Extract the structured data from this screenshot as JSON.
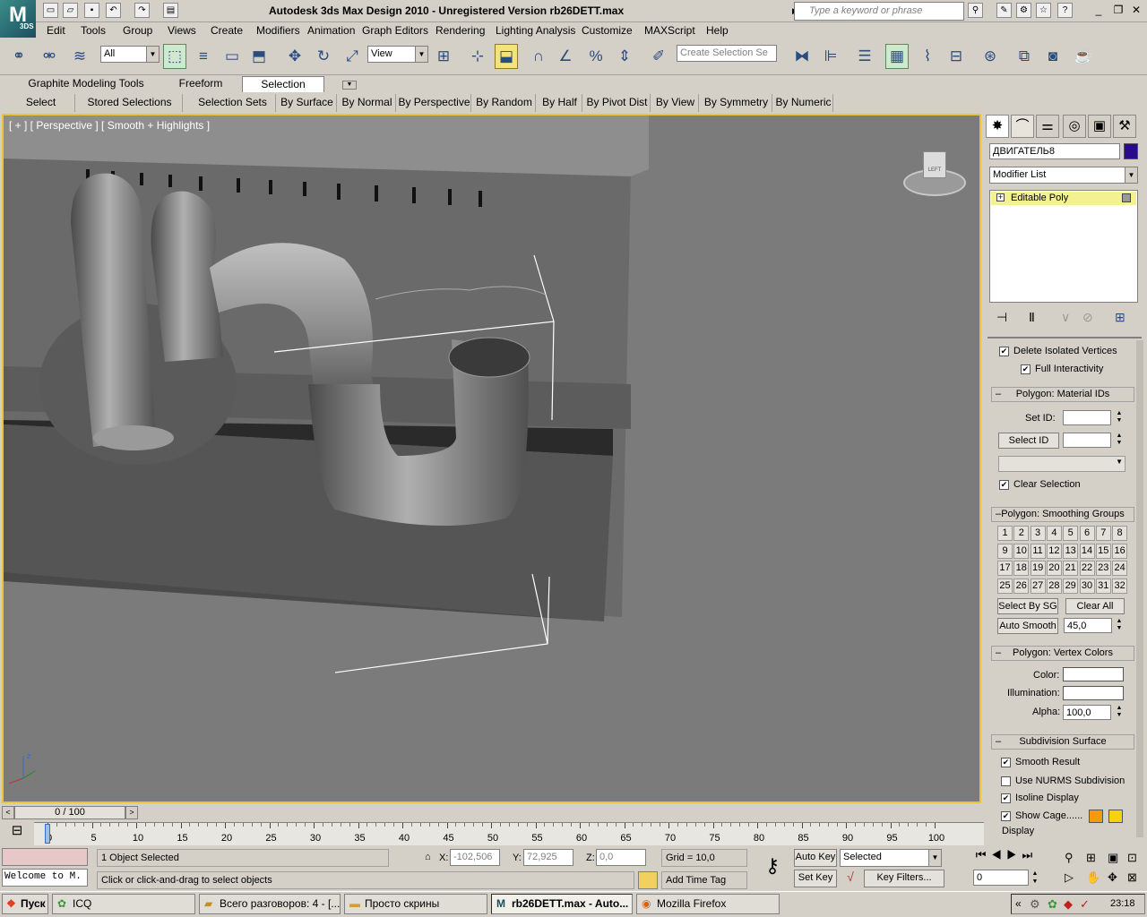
{
  "app": {
    "title": "Autodesk 3ds Max Design 2010  -  Unregistered Version    rb26DETT.max",
    "logo": "3DS"
  },
  "search": {
    "placeholder": "Type a keyword or phrase"
  },
  "menu": [
    "Edit",
    "Tools",
    "Group",
    "Views",
    "Create",
    "Modifiers",
    "Animation",
    "Graph Editors",
    "Rendering",
    "Lighting Analysis",
    "Customize",
    "MAXScript",
    "Help"
  ],
  "toolbar": {
    "filter_value": "All",
    "refcoord_value": "View",
    "named_selection_placeholder": "Create Selection Se"
  },
  "ribbon": {
    "tabs": [
      "Graphite Modeling Tools",
      "Freeform",
      "Selection"
    ],
    "buttons": [
      "Select",
      "Stored Selections",
      "Selection Sets",
      "By Surface",
      "By Normal",
      "By Perspective",
      "By Random",
      "By Half",
      "By Pivot Dist",
      "By View",
      "By Symmetry",
      "By Numeric"
    ]
  },
  "viewport": {
    "label": "[ + ] [ Perspective ] [ Smooth + Highlights ]",
    "viewcube": "LEFT"
  },
  "panel": {
    "object_name": "ДВИГАТЕЛЬ8",
    "object_color": "#2a0a8c",
    "modifier_list": "Modifier List",
    "stack_item": "Editable Poly",
    "delete_isolated": "Delete Isolated Vertices",
    "full_interactivity": "Full Interactivity",
    "matid_header": "Polygon: Material IDs",
    "set_id": "Set ID:",
    "select_id": "Select ID",
    "clear_selection": "Clear Selection",
    "smoothing_header": "Polygon: Smoothing Groups",
    "groups": [
      "1",
      "2",
      "3",
      "4",
      "5",
      "6",
      "7",
      "8",
      "9",
      "10",
      "11",
      "12",
      "13",
      "14",
      "15",
      "16",
      "17",
      "18",
      "19",
      "20",
      "21",
      "22",
      "23",
      "24",
      "25",
      "26",
      "27",
      "28",
      "29",
      "30",
      "31",
      "32"
    ],
    "select_by_sg": "Select By SG",
    "clear_all": "Clear All",
    "auto_smooth": "Auto Smooth",
    "auto_smooth_value": "45,0",
    "vertex_colors_header": "Polygon: Vertex Colors",
    "color_label": "Color:",
    "illumination_label": "Illumination:",
    "alpha_label": "Alpha:",
    "alpha_value": "100,0",
    "subdiv_header": "Subdivision Surface",
    "smooth_result": "Smooth Result",
    "use_nurms": "Use NURMS Subdivision",
    "isoline": "Isoline Display",
    "show_cage": "Show Cage......",
    "display": "Display",
    "cage_color1": "#f59a0a",
    "cage_color2": "#f5d20a"
  },
  "timeline": {
    "frame": "0 / 100",
    "ticks": [
      "0",
      "5",
      "10",
      "15",
      "20",
      "25",
      "30",
      "35",
      "40",
      "45",
      "50",
      "55",
      "60",
      "65",
      "70",
      "75",
      "80",
      "85",
      "90",
      "95",
      "100"
    ]
  },
  "status": {
    "selected": "1 Object Selected",
    "prompt": "Click or click-and-drag to select objects",
    "maxscript": "Welcome to M.",
    "x_label": "X:",
    "x": "-102,506",
    "y_label": "Y:",
    "y": "72,925",
    "z_label": "Z:",
    "z": "0,0",
    "grid": "Grid = 10,0",
    "add_time_tag": "Add Time Tag",
    "auto_key": "Auto Key",
    "set_key": "Set Key",
    "selected_mode": "Selected",
    "key_filters": "Key Filters...",
    "frame_value": "0"
  },
  "taskbar": {
    "start": "Пуск",
    "items": [
      "ICQ",
      "Всего разговоров: 4 - [...",
      "Просто скрины",
      "rb26DETT.max - Auto...",
      "Mozilla Firefox"
    ],
    "clock": "23:18"
  }
}
